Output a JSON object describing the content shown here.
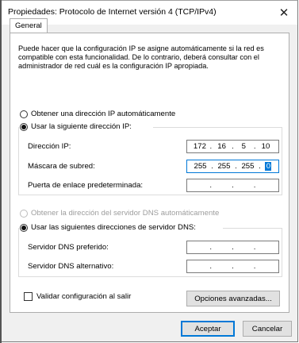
{
  "window": {
    "title": "Propiedades: Protocolo de Internet versión 4 (TCP/IPv4)",
    "close_glyph": "✕"
  },
  "tabs": [
    {
      "label": "General",
      "selected": true
    }
  ],
  "description": "Puede hacer que la configuración IP se asigne automáticamente si la red es compatible con esta funcionalidad. De lo contrario, deberá consultar con el administrador de red cuál es la configuración IP apropiada.",
  "ip_section": {
    "auto_label": "Obtener una dirección IP automáticamente",
    "manual_label": "Usar la siguiente dirección IP:",
    "fields": [
      {
        "label": "Dirección IP:",
        "octets": [
          "172",
          "16",
          "5",
          "10"
        ]
      },
      {
        "label": "Máscara de subred:",
        "octets": [
          "255",
          "255",
          "255",
          "0"
        ]
      },
      {
        "label": "Puerta de enlace predeterminada:",
        "octets": [
          "",
          "",
          "",
          ""
        ]
      }
    ]
  },
  "dns_section": {
    "auto_label": "Obtener la dirección del servidor DNS automáticamente",
    "manual_label": "Usar las siguientes direcciones de servidor DNS:",
    "fields": [
      {
        "label": "Servidor DNS preferido:",
        "octets": [
          "",
          "",
          "",
          ""
        ]
      },
      {
        "label": "Servidor DNS alternativo:",
        "octets": [
          "",
          "",
          "",
          ""
        ]
      }
    ]
  },
  "validate_checkbox": {
    "label": "Validar configuración al salir",
    "checked": false
  },
  "buttons": {
    "advanced": "Opciones avanzadas...",
    "ok": "Aceptar",
    "cancel": "Cancelar"
  },
  "colors": {
    "accent": "#0078d7",
    "disabled": "#9d9d9d"
  }
}
